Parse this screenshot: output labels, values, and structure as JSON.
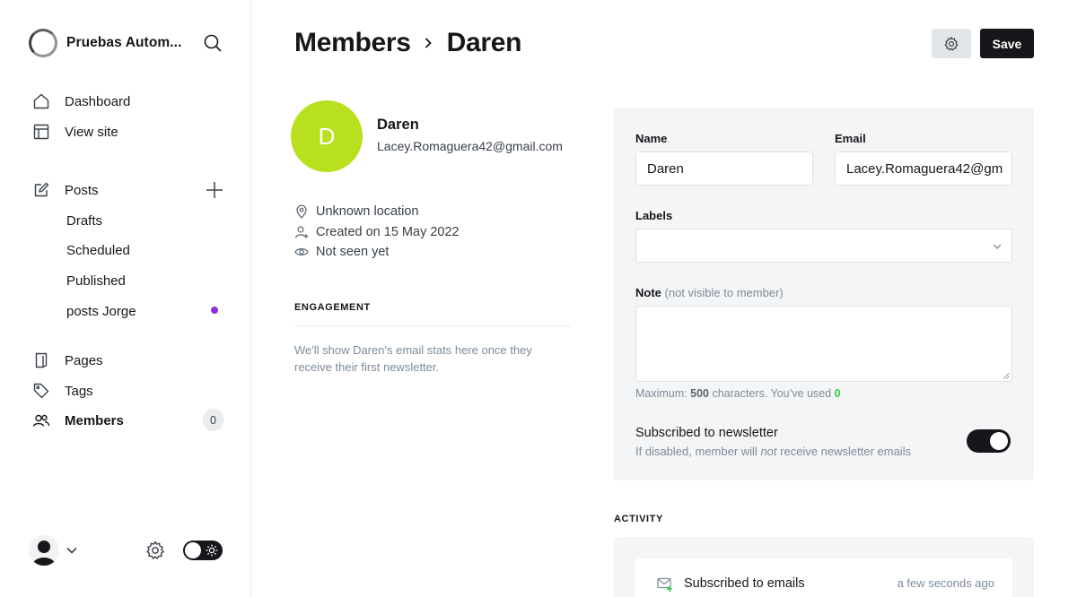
{
  "sidebar": {
    "brand": "Pruebas Autom...",
    "nav": {
      "dashboard": "Dashboard",
      "view_site": "View site",
      "posts": "Posts",
      "drafts": "Drafts",
      "scheduled": "Scheduled",
      "published": "Published",
      "posts_jorge": "posts Jorge",
      "pages": "Pages",
      "tags": "Tags",
      "members": "Members",
      "members_count": "0"
    }
  },
  "header": {
    "crumb_parent": "Members",
    "crumb_current": "Daren",
    "save_label": "Save"
  },
  "member": {
    "initial": "D",
    "name": "Daren",
    "email": "Lacey.Romaguera42@gmail.com",
    "location": "Unknown location",
    "created": "Created on 15 May 2022",
    "seen": "Not seen yet"
  },
  "engagement": {
    "heading": "ENGAGEMENT",
    "text": "We'll show Daren's email stats here once they receive their first newsletter."
  },
  "form": {
    "name_label": "Name",
    "name_value": "Daren",
    "email_label": "Email",
    "email_value": "Lacey.Romaguera42@gm",
    "labels_label": "Labels",
    "note_label": "Note",
    "note_muted": "(not visible to member)",
    "hint_prefix": "Maximum: ",
    "hint_max": "500",
    "hint_mid": " characters. You’ve used ",
    "hint_used": "0",
    "newsletter_title": "Subscribed to newsletter",
    "newsletter_sub_a": "If disabled, member will ",
    "newsletter_sub_em": "not",
    "newsletter_sub_b": " receive newsletter emails",
    "newsletter_on": true
  },
  "activity": {
    "heading": "ACTIVITY",
    "items": [
      {
        "text": "Subscribed to emails",
        "time": "a few seconds ago"
      }
    ]
  },
  "colors": {
    "avatar": "#b8e01f",
    "accent_dot": "#8e2ee6",
    "success": "#30cf43"
  }
}
